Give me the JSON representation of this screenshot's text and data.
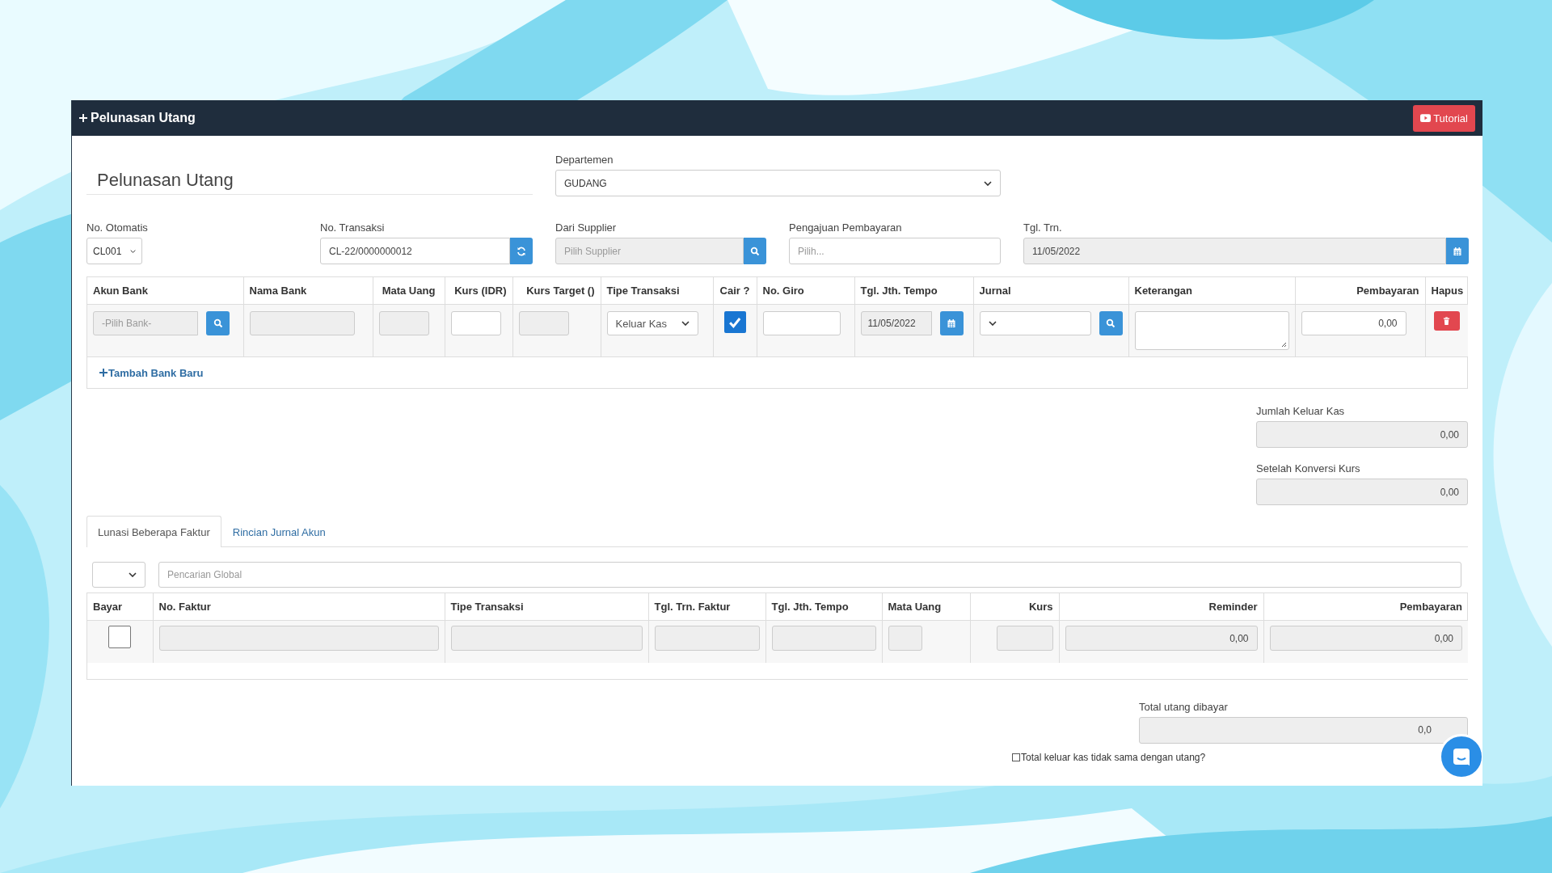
{
  "header": {
    "title": "Pelunasan Utang",
    "tutorial_button": "Tutorial"
  },
  "form_title": "Pelunasan Utang",
  "departemen": {
    "label": "Departemen",
    "value": "GUDANG"
  },
  "fields": [
    {
      "kind": "select",
      "label": "No. Otomatis",
      "value": "CL001"
    },
    {
      "kind": "refresh",
      "label": "No. Transaksi",
      "value": "CL-22/0000000012"
    },
    {
      "kind": "search",
      "label": "Dari Supplier",
      "placeholder": "Pilih Supplier"
    },
    {
      "kind": "text",
      "label": "Pengajuan Pembayaran",
      "placeholder": "Pilih..."
    },
    {
      "kind": "date",
      "label": "Tgl. Trn.",
      "value": "11/05/2022"
    }
  ],
  "bank_table": {
    "columns": [
      "Akun Bank",
      "Nama Bank",
      "Mata Uang",
      "Kurs (IDR)",
      "Kurs Target ()",
      "Tipe Transaksi",
      "Cair ?",
      "No. Giro",
      "Tgl. Jth. Tempo",
      "Jurnal",
      "Keterangan",
      "Pembayaran",
      "Hapus"
    ],
    "row": {
      "akun_bank_placeholder": "-Pilih Bank-",
      "tipe_transaksi": "Keluar Kas",
      "cair": true,
      "tgl_jth_tempo": "11/05/2022",
      "pembayaran": "0,00"
    },
    "add_link": "Tambah Bank Baru"
  },
  "totals": [
    {
      "label": "Jumlah Keluar Kas",
      "value": "0,00"
    },
    {
      "label": "Setelah Konversi Kurs",
      "value": "0,00"
    }
  ],
  "tabs": [
    {
      "label": "Lunasi Beberapa Faktur",
      "selected": true
    },
    {
      "label": "Rincian Jurnal Akun",
      "selected": false
    }
  ],
  "search": {
    "placeholder": "Pencarian Global"
  },
  "invoice_table": {
    "columns": [
      "Bayar",
      "No. Faktur",
      "Tipe Transaksi",
      "Tgl. Trn. Faktur",
      "Tgl. Jth. Tempo",
      "Mata Uang",
      "Kurs",
      "Reminder",
      "Pembayaran"
    ],
    "row": {
      "bayar": false,
      "reminder": "0,00",
      "pembayaran": "0,00"
    }
  },
  "total_utang": {
    "label": "Total utang dibayar",
    "value": "0,0"
  },
  "mismatch_checkbox": {
    "label": "Total keluar kas tidak sama dengan utang?",
    "checked": false
  }
}
